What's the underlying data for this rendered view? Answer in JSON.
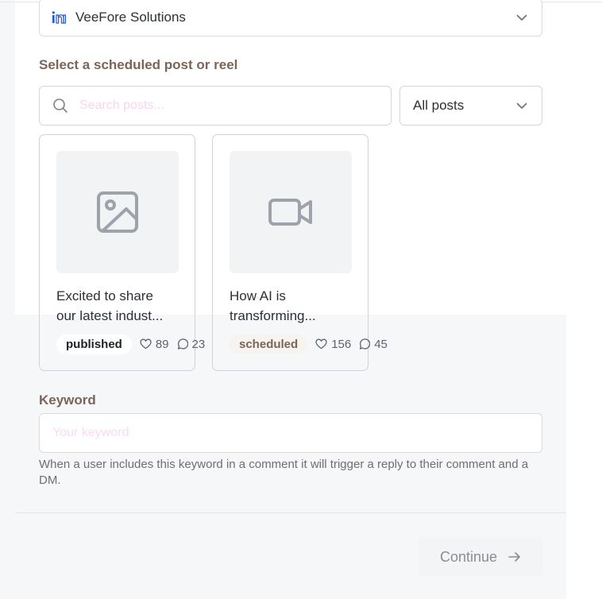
{
  "account": {
    "name": "VeeFore Solutions",
    "icon": "linkedin-icon"
  },
  "post_picker": {
    "label": "Select a scheduled post or reel",
    "search_placeholder": "Search posts...",
    "filter_value": "All posts"
  },
  "posts": [
    {
      "caption_line1": "Excited to share",
      "caption_line2": "our latest indust...",
      "status": "published",
      "likes": "89",
      "comments": "23",
      "thumb_icon": "image-icon"
    },
    {
      "caption_line1": "How AI is",
      "caption_line2": "transforming...",
      "status": "scheduled",
      "likes": "156",
      "comments": "45",
      "thumb_icon": "video-camera-icon"
    }
  ],
  "keyword": {
    "label": "Keyword",
    "placeholder": "Your keyword",
    "help": "When a user includes this keyword in a comment it will trigger a reply to their comment and a DM."
  },
  "footer": {
    "continue_label": "Continue"
  },
  "colors": {
    "accent": "#7a6559",
    "linkedin": "#1f5bd6"
  }
}
